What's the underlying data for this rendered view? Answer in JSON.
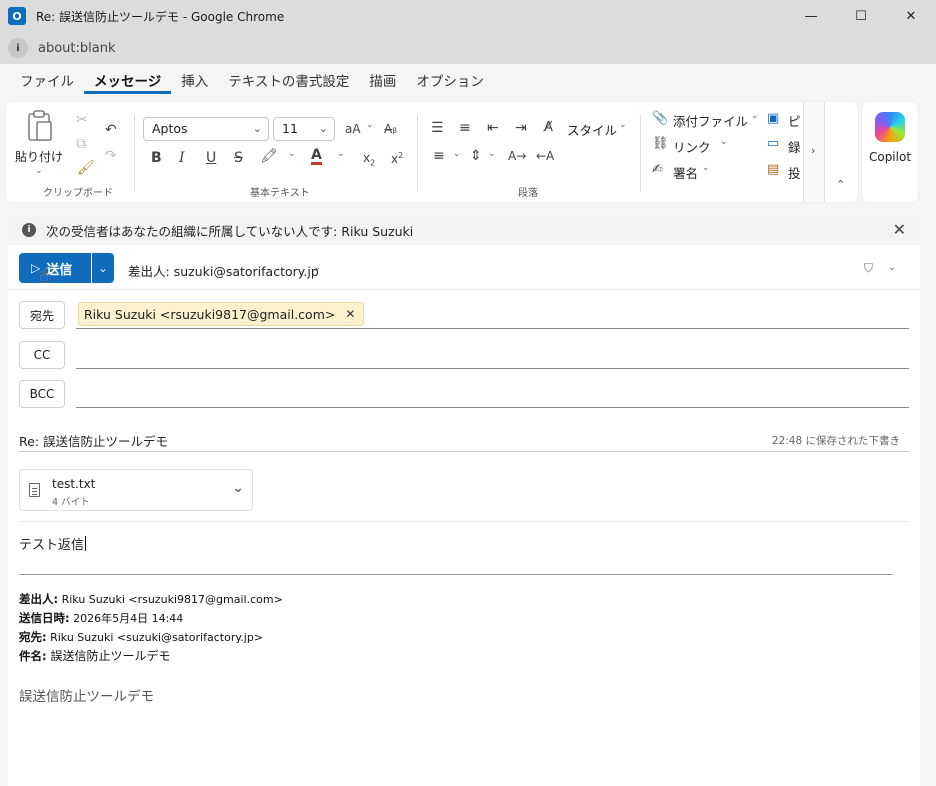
{
  "window": {
    "title": "Re: 誤送信防止ツールデモ - Google Chrome",
    "app_icon_letter": "O",
    "minimize": "—",
    "maximize": "☐",
    "close": "✕"
  },
  "address_bar": {
    "url": "about:blank"
  },
  "ribbon_tabs": [
    {
      "label": "ファイル"
    },
    {
      "label": "メッセージ"
    },
    {
      "label": "挿入"
    },
    {
      "label": "テキストの書式設定"
    },
    {
      "label": "描画"
    },
    {
      "label": "オプション"
    }
  ],
  "ribbon": {
    "clipboard": {
      "paste_label": "貼り付け",
      "group_label": "クリップボード"
    },
    "basic_text": {
      "font_name": "Aptos",
      "font_size": "11",
      "group_label": "基本テキスト",
      "font_color": "#c0392b",
      "highlight_color": "#f4e64a"
    },
    "paragraph": {
      "styles_label": "スタイル",
      "group_label": "段落"
    },
    "insert": {
      "attach_file": "添付ファイル",
      "link": "リンク",
      "signature": "署名",
      "truncated_1": "ピ",
      "truncated_2": "録",
      "truncated_3": "投"
    },
    "copilot_label": "Copilot"
  },
  "compose": {
    "info_message": "次の受信者はあなたの組織に所属していない人です: Riku Suzuki",
    "send_label": "送信",
    "from_label": "差出人: suzuki@satorifactory.jp",
    "to_button": "宛先",
    "cc_button": "CC",
    "bcc_button": "BCC",
    "to_recipient": "Riku Suzuki <rsuzuki9817@gmail.com>",
    "subject": "Re: 誤送信防止ツールデモ",
    "saved_status": "22:48 に保存された下書き",
    "attachment": {
      "name": "test.txt",
      "size": "4 バイト"
    },
    "body_text": "テスト返信",
    "quoted": {
      "from_label": "差出人:",
      "from_value": "Riku Suzuki <rsuzuki9817@gmail.com>",
      "sent_label": "送信日時:",
      "sent_value": "2026年5月4日 14:44",
      "to_label": "宛先:",
      "to_value": "Riku Suzuki <suzuki@satorifactory.jp>",
      "subject_label": "件名:",
      "subject_value": "誤送信防止ツールデモ",
      "body": "誤送信防止ツールデモ"
    }
  },
  "colors": {
    "accent": "#0f6cbd",
    "chip_bg": "#fdf1cf"
  }
}
